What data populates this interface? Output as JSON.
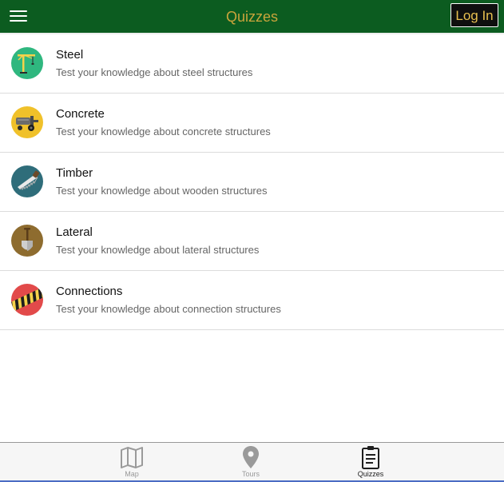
{
  "header": {
    "title": "Quizzes",
    "login_label": "Log In"
  },
  "quizzes": [
    {
      "name": "Steel",
      "description": "Test your knowledge about steel structures",
      "icon": "crane-icon",
      "color": "#2fb77f"
    },
    {
      "name": "Concrete",
      "description": "Test your knowledge about concrete structures",
      "icon": "concrete-mixer-icon",
      "color": "#f0c12a"
    },
    {
      "name": "Timber",
      "description": "Test your knowledge about wooden structures",
      "icon": "saw-icon",
      "color": "#2f6d7a"
    },
    {
      "name": "Lateral",
      "description": "Test your knowledge about lateral structures",
      "icon": "shovel-icon",
      "color": "#8e6c2f"
    },
    {
      "name": "Connections",
      "description": "Test your knowledge about connection structures",
      "icon": "caution-stripes-icon",
      "color": "#e24a4a"
    }
  ],
  "tabs": [
    {
      "label": "Map",
      "icon": "map-icon",
      "active": false
    },
    {
      "label": "Tours",
      "icon": "location-pin-icon",
      "active": false
    },
    {
      "label": "Quizzes",
      "icon": "clipboard-icon",
      "active": true
    }
  ],
  "colors": {
    "header_bg": "#0c5c20",
    "title": "#c9a43b",
    "login_text": "#e8c04f"
  }
}
